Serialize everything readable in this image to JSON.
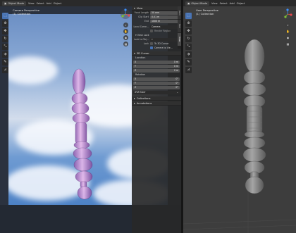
{
  "left_view": {
    "header": {
      "mode": "Object Mode",
      "menus": [
        "View",
        "Select",
        "Add",
        "Object"
      ]
    },
    "title": "Camera Perspective",
    "collection": "(1) Collection"
  },
  "right_view": {
    "header": {
      "mode": "Object Mode",
      "menus": [
        "View",
        "Select",
        "Add",
        "Object"
      ]
    },
    "title": "User Perspective",
    "collection": "(1) Collection"
  },
  "toolbar": {
    "tools": [
      {
        "name": "select-box-tool",
        "glyph": "⬚"
      },
      {
        "name": "cursor-tool",
        "glyph": "⊕"
      },
      {
        "name": "move-tool",
        "glyph": "✥"
      },
      {
        "name": "rotate-tool",
        "glyph": "↻"
      },
      {
        "name": "scale-tool",
        "glyph": "⤡"
      },
      {
        "name": "transform-tool",
        "glyph": "⬗"
      },
      {
        "name": "annotate-tool",
        "glyph": "✎"
      },
      {
        "name": "measure-tool",
        "glyph": "⊿"
      }
    ]
  },
  "sidebar": {
    "tabs": [
      "Item",
      "Tool",
      "View"
    ],
    "view_panel": {
      "title": "View",
      "focal_label": "Focal Length",
      "focal_value": "50 mm",
      "clip_start_label": "Clip Start",
      "clip_start_value": "0.01 m",
      "clip_end_label": "End",
      "clip_end_value": "1000 m",
      "local_camera_label": "Local Came...",
      "local_camera_value": "Camera",
      "render_region_label": "Render Region"
    },
    "view_lock": {
      "title": "View Lock",
      "lock_to_object_label": "Lock to Obj...",
      "lock_label": "Lock",
      "to_3d_cursor_label": "To 3D Cursor",
      "camera_to_view_label": "Camera to Vie..."
    },
    "cursor_panel": {
      "title": "3D Cursor",
      "location_label": "Location",
      "x_label": "X",
      "x_value": "0 m",
      "y_label": "Y",
      "y_value": "0 m",
      "z_label": "Z",
      "z_value": "0 m",
      "rotation_label": "Rotation",
      "rx_value": "0°",
      "ry_value": "0°",
      "rz_value": "0°",
      "rotation_mode": "XYZ Euler"
    },
    "collections_title": "Collections",
    "annotations_title": "Annotations"
  },
  "colors": {
    "accent": "#4772b3",
    "object_render": "#c98fd6",
    "object_solid": "#8a8a8a",
    "axis_x": "#e5484d",
    "axis_y": "#7fc035",
    "axis_z": "#3d8ef7"
  }
}
